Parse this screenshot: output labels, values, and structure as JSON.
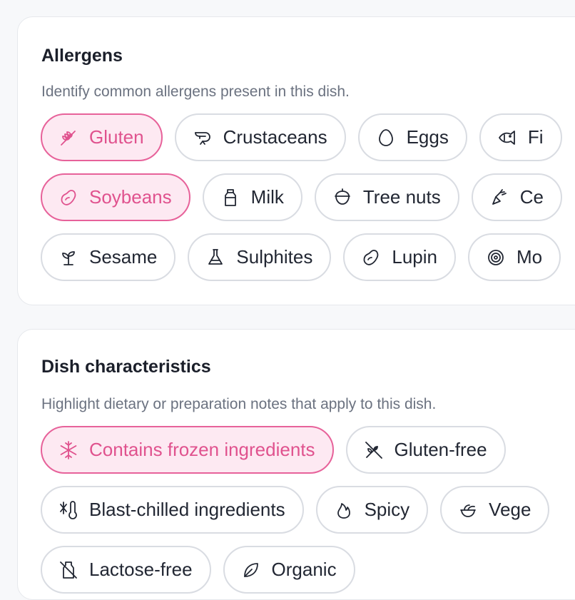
{
  "allergens": {
    "title": "Allergens",
    "subtitle": "Identify common allergens present in this dish.",
    "rows": [
      [
        {
          "label": "Gluten",
          "icon": "wheat-icon",
          "selected": true
        },
        {
          "label": "Crustaceans",
          "icon": "shrimp-icon",
          "selected": false
        },
        {
          "label": "Eggs",
          "icon": "egg-icon",
          "selected": false
        },
        {
          "label": "Fi",
          "icon": "fish-icon",
          "selected": false
        }
      ],
      [
        {
          "label": "Soybeans",
          "icon": "bean-icon",
          "selected": true
        },
        {
          "label": "Milk",
          "icon": "milk-icon",
          "selected": false
        },
        {
          "label": "Tree nuts",
          "icon": "nut-icon",
          "selected": false
        },
        {
          "label": "Ce",
          "icon": "carrot-icon",
          "selected": false
        }
      ],
      [
        {
          "label": "Sesame",
          "icon": "sprout-icon",
          "selected": false
        },
        {
          "label": "Sulphites",
          "icon": "flask-icon",
          "selected": false
        },
        {
          "label": "Lupin",
          "icon": "bean-icon",
          "selected": false
        },
        {
          "label": "Mo",
          "icon": "shell-icon",
          "selected": false
        }
      ]
    ]
  },
  "dish": {
    "title": "Dish characteristics",
    "subtitle": "Highlight dietary or preparation notes that apply to this dish.",
    "rows": [
      [
        {
          "label": "Contains frozen ingredients",
          "icon": "snowflake-icon",
          "selected": true
        },
        {
          "label": "Gluten-free",
          "icon": "wheat-off-icon",
          "selected": false
        }
      ],
      [
        {
          "label": "Blast-chilled ingredients",
          "icon": "thermometer-snowflake-icon",
          "selected": false
        },
        {
          "label": "Spicy",
          "icon": "flame-icon",
          "selected": false
        },
        {
          "label": "Vege",
          "icon": "salad-icon",
          "selected": false
        }
      ],
      [
        {
          "label": "Lactose-free",
          "icon": "milk-off-icon",
          "selected": false
        },
        {
          "label": "Organic",
          "icon": "leaf-icon",
          "selected": false
        }
      ]
    ]
  },
  "colors": {
    "accent": "#e0528e",
    "accent_bg": "#fde9f2",
    "border": "#d9dce2"
  }
}
